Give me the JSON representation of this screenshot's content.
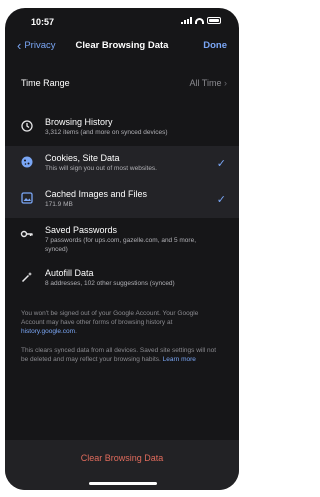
{
  "status": {
    "time": "10:57"
  },
  "nav": {
    "back_label": "Privacy",
    "title": "Clear Browsing Data",
    "done_label": "Done"
  },
  "time_range": {
    "label": "Time Range",
    "value": "All Time"
  },
  "items": [
    {
      "icon": "history-icon",
      "title": "Browsing History",
      "subtitle": "3,312 items (and more on synced devices)",
      "selected": false
    },
    {
      "icon": "cookie-icon",
      "title": "Cookies, Site Data",
      "subtitle": "This will sign you out of most websites.",
      "selected": true
    },
    {
      "icon": "image-icon",
      "title": "Cached Images and Files",
      "subtitle": "171.9 MB",
      "selected": true
    },
    {
      "icon": "key-icon",
      "title": "Saved Passwords",
      "subtitle": "7 passwords (for ups.com, gazelle.com, and 5 more, synced)",
      "selected": false
    },
    {
      "icon": "autofill-icon",
      "title": "Autofill Data",
      "subtitle": "8 addresses, 102 other suggestions (synced)",
      "selected": false
    }
  ],
  "notes": {
    "account_text": "You won't be signed out of your Google Account. Your Google Account may have other forms of browsing history at",
    "account_link": "history.google.com",
    "account_end": ".",
    "sync_text": "This clears synced data from all devices. Saved site settings will not be deleted and may reflect your browsing habits.",
    "learn_more": "Learn more"
  },
  "bottom": {
    "clear_label": "Clear Browsing Data"
  },
  "colors": {
    "background": "#161618",
    "accent": "#7aa6f5",
    "destructive": "#e06b5c",
    "selected_row": "#232327"
  }
}
